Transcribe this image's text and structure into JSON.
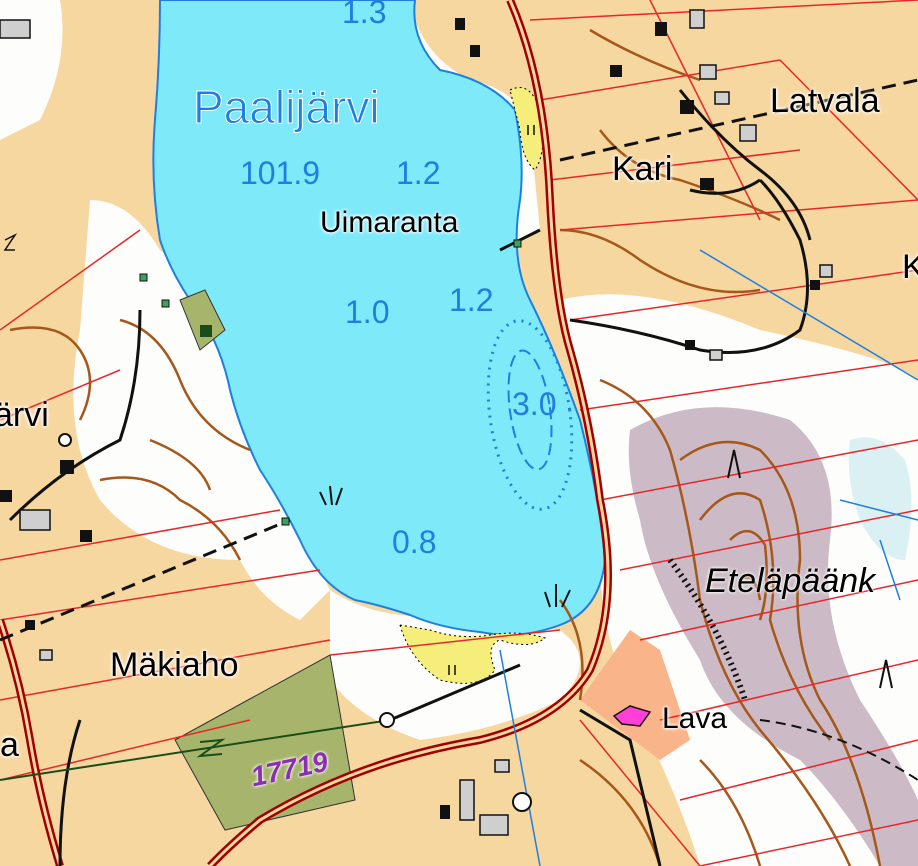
{
  "map": {
    "lake_name": "Paalijärvi",
    "elevation": "101.9",
    "depths": [
      "1.3",
      "1.2",
      "1.2",
      "1.0",
      "3.0",
      "0.8"
    ],
    "places": {
      "latvala": "Latvala",
      "kari": "Kari",
      "uimaranta": "Uimaranta",
      "makiaho": "Mäkiaho",
      "etelapaank": "Eteläpäänk",
      "lava": "Lava",
      "left_jarvi": "ärvi",
      "left_a": "a",
      "right_k": "K"
    },
    "parcel_number": "17719",
    "colors": {
      "field": "#f7d7a0",
      "water": "#7ee9f9",
      "forest": "#fdfdfb",
      "road": "#c00000",
      "property_line": "#e8262a",
      "contour": "#a5581a",
      "hill": "#c6b4c0",
      "parcel": "#a6b56b",
      "poi": "#ff3fd8"
    }
  }
}
